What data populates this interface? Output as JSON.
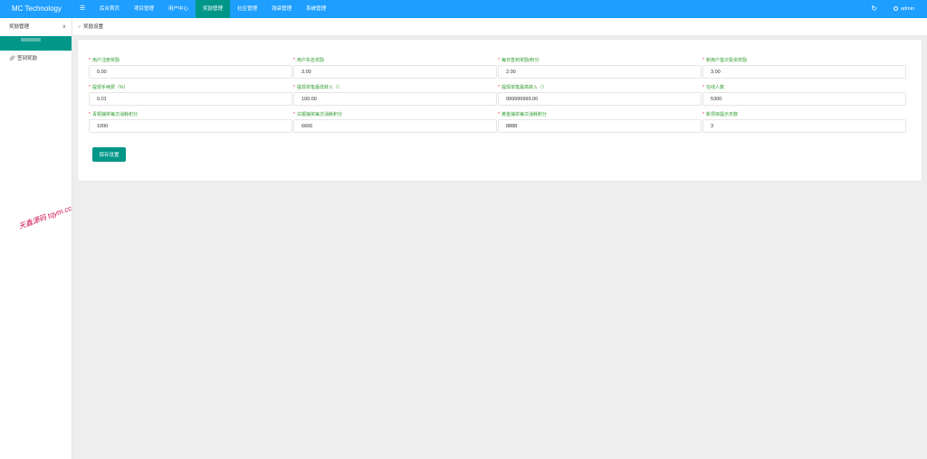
{
  "header": {
    "brand": "MC Technology",
    "menu_toggle_icon": "☰",
    "nav": [
      "后台首页",
      "项目管理",
      "用户中心",
      "奖励管理",
      "社区管理",
      "钱袋管理",
      "系统管理"
    ],
    "active_nav_index": 3,
    "refresh_icon": "↻",
    "username": "admin"
  },
  "sidebar": {
    "group_label": "奖励管理",
    "chevron": "∨",
    "items": [
      {
        "label": "签到奖励",
        "icon": "🔗"
      }
    ]
  },
  "watermark": "天鑫源码 tqym.cc",
  "breadcrumb": {
    "separator": "»",
    "label": "奖励设置"
  },
  "form": {
    "required_mark": "*",
    "fields": [
      {
        "label": "用户注册奖励",
        "value": "0.00"
      },
      {
        "label": "用户实名奖励",
        "value": "3.00"
      },
      {
        "label": "每日签到奖励/积分",
        "value": "2.00"
      },
      {
        "label": "新用户首次投资奖励",
        "value": "3.00"
      },
      {
        "label": "提现手续费（%）",
        "value": "0.01"
      },
      {
        "label": "提现单笔最低转入（）",
        "value": "100.00"
      },
      {
        "label": "提现单笔最高转入（）",
        "value": "999999999.00"
      },
      {
        "label": "在线人数",
        "value": "5300"
      },
      {
        "label": "青铜抽奖每次消耗积分",
        "value": "1000"
      },
      {
        "label": "白银抽奖每次消耗积分",
        "value": "6666"
      },
      {
        "label": "黄金抽奖每次消耗积分",
        "value": "8888"
      },
      {
        "label": "新项目提示天数",
        "value": "3"
      }
    ],
    "save_label": "保存设置"
  },
  "colors": {
    "header_bg": "#1e9fff",
    "accent": "#009688",
    "label_green": "#2e9c2e",
    "required_red": "#ff3030",
    "watermark": "#d1155a"
  }
}
